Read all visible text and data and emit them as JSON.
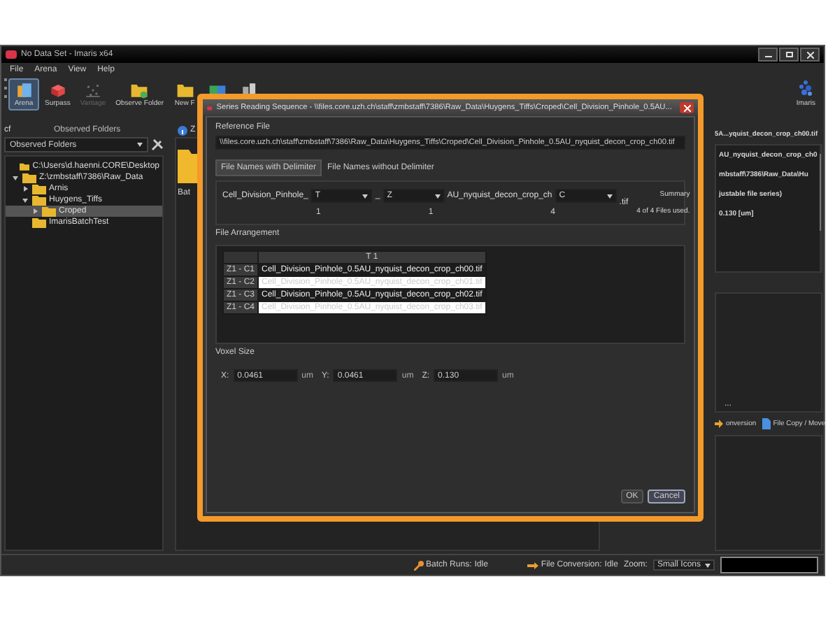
{
  "window": {
    "title": "No Data Set - Imaris x64"
  },
  "menu": [
    "File",
    "Arena",
    "View",
    "Help"
  ],
  "toolbar": [
    {
      "label": "Arena",
      "kind": "arena",
      "selected": true,
      "disabled": false
    },
    {
      "label": "Surpass",
      "kind": "surpass",
      "selected": false,
      "disabled": false
    },
    {
      "label": "Vantage",
      "kind": "vantage",
      "selected": false,
      "disabled": true
    },
    {
      "label": "Observe Folder",
      "kind": "observe",
      "selected": false,
      "disabled": false
    },
    {
      "label": "New F",
      "kind": "newfolder",
      "selected": false,
      "disabled": false
    },
    {
      "kind": "cubes",
      "selected": false,
      "disabled": false
    },
    {
      "kind": "servers",
      "selected": false,
      "disabled": false
    }
  ],
  "logo": {
    "label": "Imaris"
  },
  "left_panel": {
    "corner": "cf",
    "title": "Observed Folders",
    "dropdown": "Observed Folders",
    "tree": [
      {
        "label": "C:\\Users\\d.haenni.CORE\\Desktop",
        "selected": false
      },
      {
        "label": "Z:\\zmbstaff\\7386\\Raw_Data",
        "expanded": true,
        "selected": false,
        "children": [
          {
            "label": "Arnis",
            "expanded": false,
            "selected": false
          },
          {
            "label": "Huygens_Tiffs",
            "expanded": true,
            "selected": false,
            "children": [
              {
                "label": "Croped",
                "expanded": false,
                "selected": true
              }
            ]
          },
          {
            "label": "ImarisBatchTest",
            "selected": false
          }
        ]
      }
    ]
  },
  "middle_panel": {
    "header": "Z",
    "item": "Bat"
  },
  "right_panel": {
    "file": "5A...yquist_decon_crop_ch00.tif",
    "list": [
      "AU_nyquist_decon_crop_ch0",
      "mbstaff\\7386\\Raw_Data\\Hu",
      "justable file series)",
      "0.130 [um]"
    ],
    "more": "...",
    "actions": [
      {
        "label": "onversion",
        "kind": "convert"
      },
      {
        "label": "File Copy / Move",
        "kind": "copy"
      }
    ]
  },
  "status_bar": {
    "batch_label": "Batch Runs:",
    "batch_value": "Idle",
    "conversion_label": "File Conversion:",
    "conversion_value": "Idle",
    "zoom_label": "Zoom:",
    "zoom_value": "Small Icons"
  },
  "dialog": {
    "title": "Series Reading Sequence - \\\\files.core.uzh.ch\\staff\\zmbstaff\\7386\\Raw_Data\\Huygens_Tiffs\\Croped\\Cell_Division_Pinhole_0.5AU...",
    "reference_label": "Reference File",
    "reference_path": "\\\\files.core.uzh.ch\\staff\\zmbstaff\\7386\\Raw_Data\\Huygens_Tiffs\\Croped\\Cell_Division_Pinhole_0.5AU_nyquist_decon_crop_ch00.tif",
    "tabs": [
      {
        "label": "File Names with Delimiter",
        "selected": true
      },
      {
        "label": "File Names without Delimiter",
        "selected": false
      }
    ],
    "delimiter": {
      "segments": [
        {
          "prefix": "Cell_Division_Pinhole_",
          "value": "T",
          "count": "1"
        },
        {
          "prefix": "_",
          "value": "Z",
          "count": "1"
        },
        {
          "prefix": "AU_nyquist_decon_crop_ch",
          "value": "C",
          "count": "4"
        }
      ],
      "suffix": ".tif",
      "summary_label": "Summary",
      "summary": "4 of 4 Files used."
    },
    "arrangement": {
      "label": "File Arrangement",
      "column": "T 1",
      "rows": [
        {
          "header": "Z1 - C1",
          "file": "Cell_Division_Pinhole_0.5AU_nyquist_decon_crop_ch00.tif",
          "selected": false
        },
        {
          "header": "Z1 - C2",
          "file": "Cell_Division_Pinhole_0.5AU_nyquist_decon_crop_ch01.tif",
          "selected": true
        },
        {
          "header": "Z1 - C3",
          "file": "Cell_Division_Pinhole_0.5AU_nyquist_decon_crop_ch02.tif",
          "selected": false
        },
        {
          "header": "Z1 - C4",
          "file": "Cell_Division_Pinhole_0.5AU_nyquist_decon_crop_ch03.tif",
          "selected": true
        }
      ]
    },
    "voxel": {
      "label": "Voxel Size",
      "fields": [
        {
          "label": "X:",
          "value": "0.0461",
          "unit": "um"
        },
        {
          "label": "Y:",
          "value": "0.0461",
          "unit": "um"
        },
        {
          "label": "Z:",
          "value": "0.130",
          "unit": "um"
        }
      ]
    },
    "buttons": [
      {
        "label": "OK",
        "focused": false
      },
      {
        "label": "Cancel",
        "focused": true
      }
    ]
  }
}
